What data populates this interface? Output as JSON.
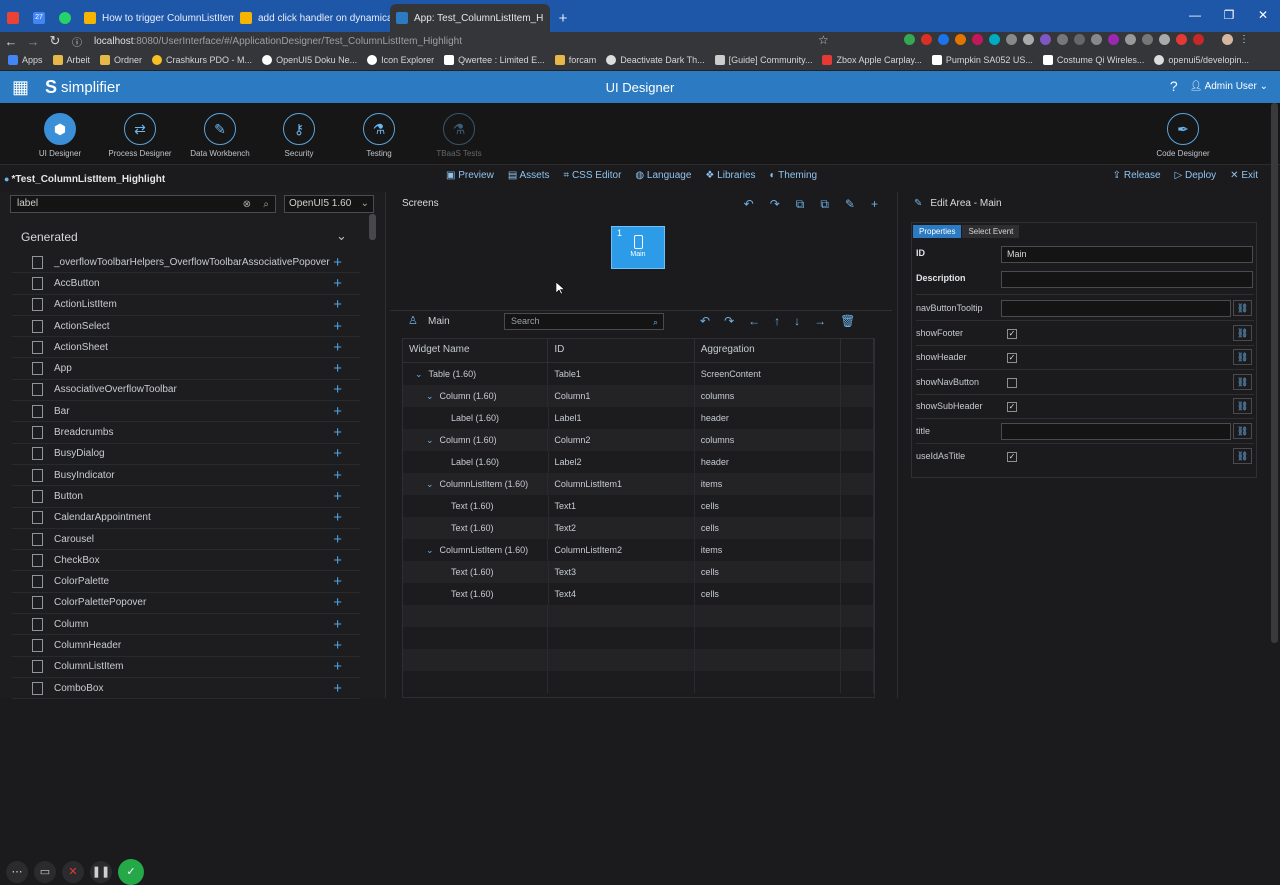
{
  "browser": {
    "tabs": [
      {
        "label": "How to trigger ColumnListItem's",
        "color": "#f4b400"
      },
      {
        "label": "add click handler on dynamically",
        "color": "#f4b400"
      },
      {
        "label": "App: Test_ColumnListItem_H",
        "color": "#2b7ac2"
      }
    ],
    "pinned": [
      "27"
    ],
    "url_host": "localhost",
    "url_path": ":8080/UserInterface/#/ApplicationDesigner/Test_ColumnListItem_Highlight",
    "bookmarks": [
      "Apps",
      "Arbeit",
      "Ordner",
      "Crashkurs PDO - M...",
      "OpenUI5 Doku Ne...",
      "Icon Explorer",
      "Qwertee : Limited E...",
      "forcam",
      "Deactivate Dark Th...",
      "[Guide] Community...",
      "Zbox Apple Carplay...",
      "Pumpkin SA052 US...",
      "Costume Qi Wireles...",
      "openui5/developin..."
    ]
  },
  "app": {
    "brand": "simplifier",
    "title": "UI Designer",
    "user": "Admin User"
  },
  "modules": [
    {
      "label": "UI Designer",
      "icon": "cube-icon"
    },
    {
      "label": "Process Designer",
      "icon": "process-icon"
    },
    {
      "label": "Data Workbench",
      "icon": "wrench-icon"
    },
    {
      "label": "Security",
      "icon": "key-icon"
    },
    {
      "label": "Testing",
      "icon": "flask-icon"
    },
    {
      "label": "TBaaS Tests",
      "icon": "flask-icon"
    },
    {
      "label": "Code Designer",
      "icon": "pen-icon"
    }
  ],
  "project": {
    "name": "*Test_ColumnListItem_Highlight",
    "menu": [
      "Preview",
      "Assets",
      "CSS Editor",
      "Language",
      "Libraries",
      "Theming"
    ],
    "actions": [
      "Release",
      "Deploy",
      "Exit"
    ]
  },
  "left": {
    "search_value": "label",
    "version": "OpenUI5 1.60",
    "group": "Generated",
    "widgets": [
      "_overflowToolbarHelpers_OverflowToolbarAssociativePopover",
      "AccButton",
      "ActionListItem",
      "ActionSelect",
      "ActionSheet",
      "App",
      "AssociativeOverflowToolbar",
      "Bar",
      "Breadcrumbs",
      "BusyDialog",
      "BusyIndicator",
      "Button",
      "CalendarAppointment",
      "Carousel",
      "CheckBox",
      "ColorPalette",
      "ColorPalettePopover",
      "Column",
      "ColumnHeader",
      "ColumnListItem",
      "ComboBox"
    ]
  },
  "center": {
    "screens_label": "Screens",
    "screen": {
      "number": "1",
      "name": "Main"
    },
    "tree_label": "Main",
    "search_placeholder": "Search",
    "columns": [
      "Widget Name",
      "ID",
      "Aggregation"
    ],
    "rows": [
      {
        "name": "Table (1.60)",
        "id": "Table1",
        "agg": "ScreenContent",
        "level": 0,
        "chev": true
      },
      {
        "name": "Column (1.60)",
        "id": "Column1",
        "agg": "columns",
        "level": 1,
        "chev": true
      },
      {
        "name": "Label (1.60)",
        "id": "Label1",
        "agg": "header",
        "level": 2,
        "chev": false
      },
      {
        "name": "Column (1.60)",
        "id": "Column2",
        "agg": "columns",
        "level": 1,
        "chev": true
      },
      {
        "name": "Label (1.60)",
        "id": "Label2",
        "agg": "header",
        "level": 2,
        "chev": false
      },
      {
        "name": "ColumnListItem (1.60)",
        "id": "ColumnListItem1",
        "agg": "items",
        "level": 1,
        "chev": true
      },
      {
        "name": "Text (1.60)",
        "id": "Text1",
        "agg": "cells",
        "level": 2,
        "chev": false
      },
      {
        "name": "Text (1.60)",
        "id": "Text2",
        "agg": "cells",
        "level": 2,
        "chev": false
      },
      {
        "name": "ColumnListItem (1.60)",
        "id": "ColumnListItem2",
        "agg": "items",
        "level": 1,
        "chev": true
      },
      {
        "name": "Text (1.60)",
        "id": "Text3",
        "agg": "cells",
        "level": 2,
        "chev": false
      },
      {
        "name": "Text (1.60)",
        "id": "Text4",
        "agg": "cells",
        "level": 2,
        "chev": false
      }
    ]
  },
  "right": {
    "title": "Edit Area - Main",
    "tabs": [
      "Properties",
      "Select Event"
    ],
    "id_label": "ID",
    "id_value": "Main",
    "description_label": "Description",
    "description_value": "",
    "props": [
      {
        "label": "navButtonTooltip",
        "type": "text",
        "value": ""
      },
      {
        "label": "showFooter",
        "type": "check",
        "checked": true
      },
      {
        "label": "showHeader",
        "type": "check",
        "checked": true
      },
      {
        "label": "showNavButton",
        "type": "check",
        "checked": false
      },
      {
        "label": "showSubHeader",
        "type": "check",
        "checked": true
      },
      {
        "label": "title",
        "type": "text",
        "value": ""
      },
      {
        "label": "useIdAsTitle",
        "type": "check",
        "checked": true
      }
    ]
  }
}
